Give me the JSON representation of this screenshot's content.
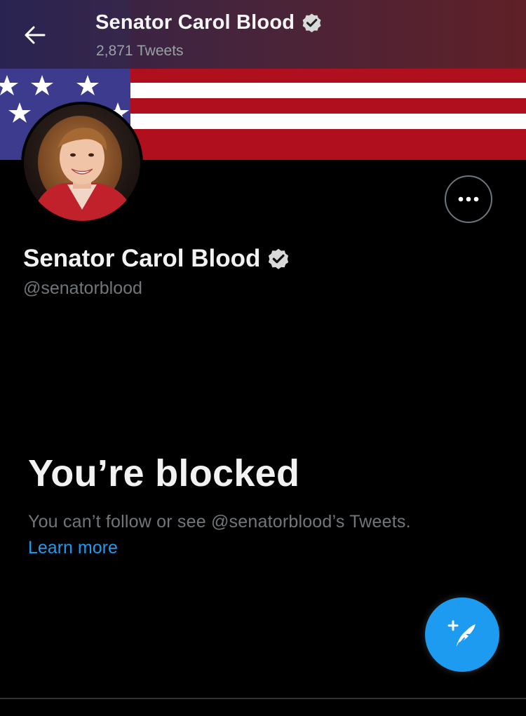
{
  "header": {
    "title": "Senator Carol Blood",
    "tweet_count": "2,871 Tweets",
    "back_icon": "arrow-left-icon",
    "verified_icon": "verified-badge-icon"
  },
  "profile": {
    "name": "Senator Carol Blood",
    "handle": "@senatorblood",
    "verified_icon": "verified-badge-icon",
    "more_icon": "ellipsis-icon",
    "banner": "us-flag"
  },
  "blocked": {
    "title": "You’re blocked",
    "message": "You can’t follow or see @senatorblood’s Tweets.",
    "learn_more": "Learn more"
  },
  "compose": {
    "icon": "compose-feather-icon"
  },
  "colors": {
    "background": "#000000",
    "accent": "#1d9bf0",
    "secondary_text": "#71767b",
    "flag_red": "#b0101e",
    "flag_blue": "#3c3b8e"
  }
}
